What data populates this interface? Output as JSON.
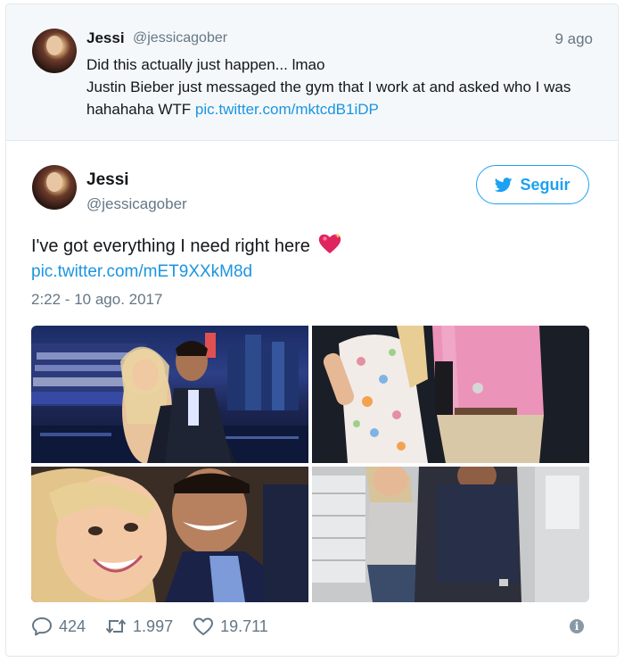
{
  "parent_tweet": {
    "name": "Jessi",
    "handle": "@jessicagober",
    "time": "9 ago",
    "line1": "Did this actually just happen... lmao",
    "line2": "Justin Bieber just messaged the gym that I work at and asked who I was hahahaha WTF ",
    "link": "pic.twitter.com/mktcdB1iDP"
  },
  "tweet": {
    "name": "Jessi",
    "handle": "@jessicagober",
    "follow_label": "Seguir",
    "text": "I've got everything I need right here",
    "link": "pic.twitter.com/mET9XXkM8d",
    "date": "2:22 - 10 ago. 2017",
    "emoji": "heart-emoji"
  },
  "actions": {
    "replies": "424",
    "retweets": "1.997",
    "likes": "19.711",
    "info_label": "i"
  },
  "colors": {
    "accent": "#1da1f2",
    "link": "#1b95e0",
    "muted": "#657786",
    "heart": "#e0245e"
  }
}
